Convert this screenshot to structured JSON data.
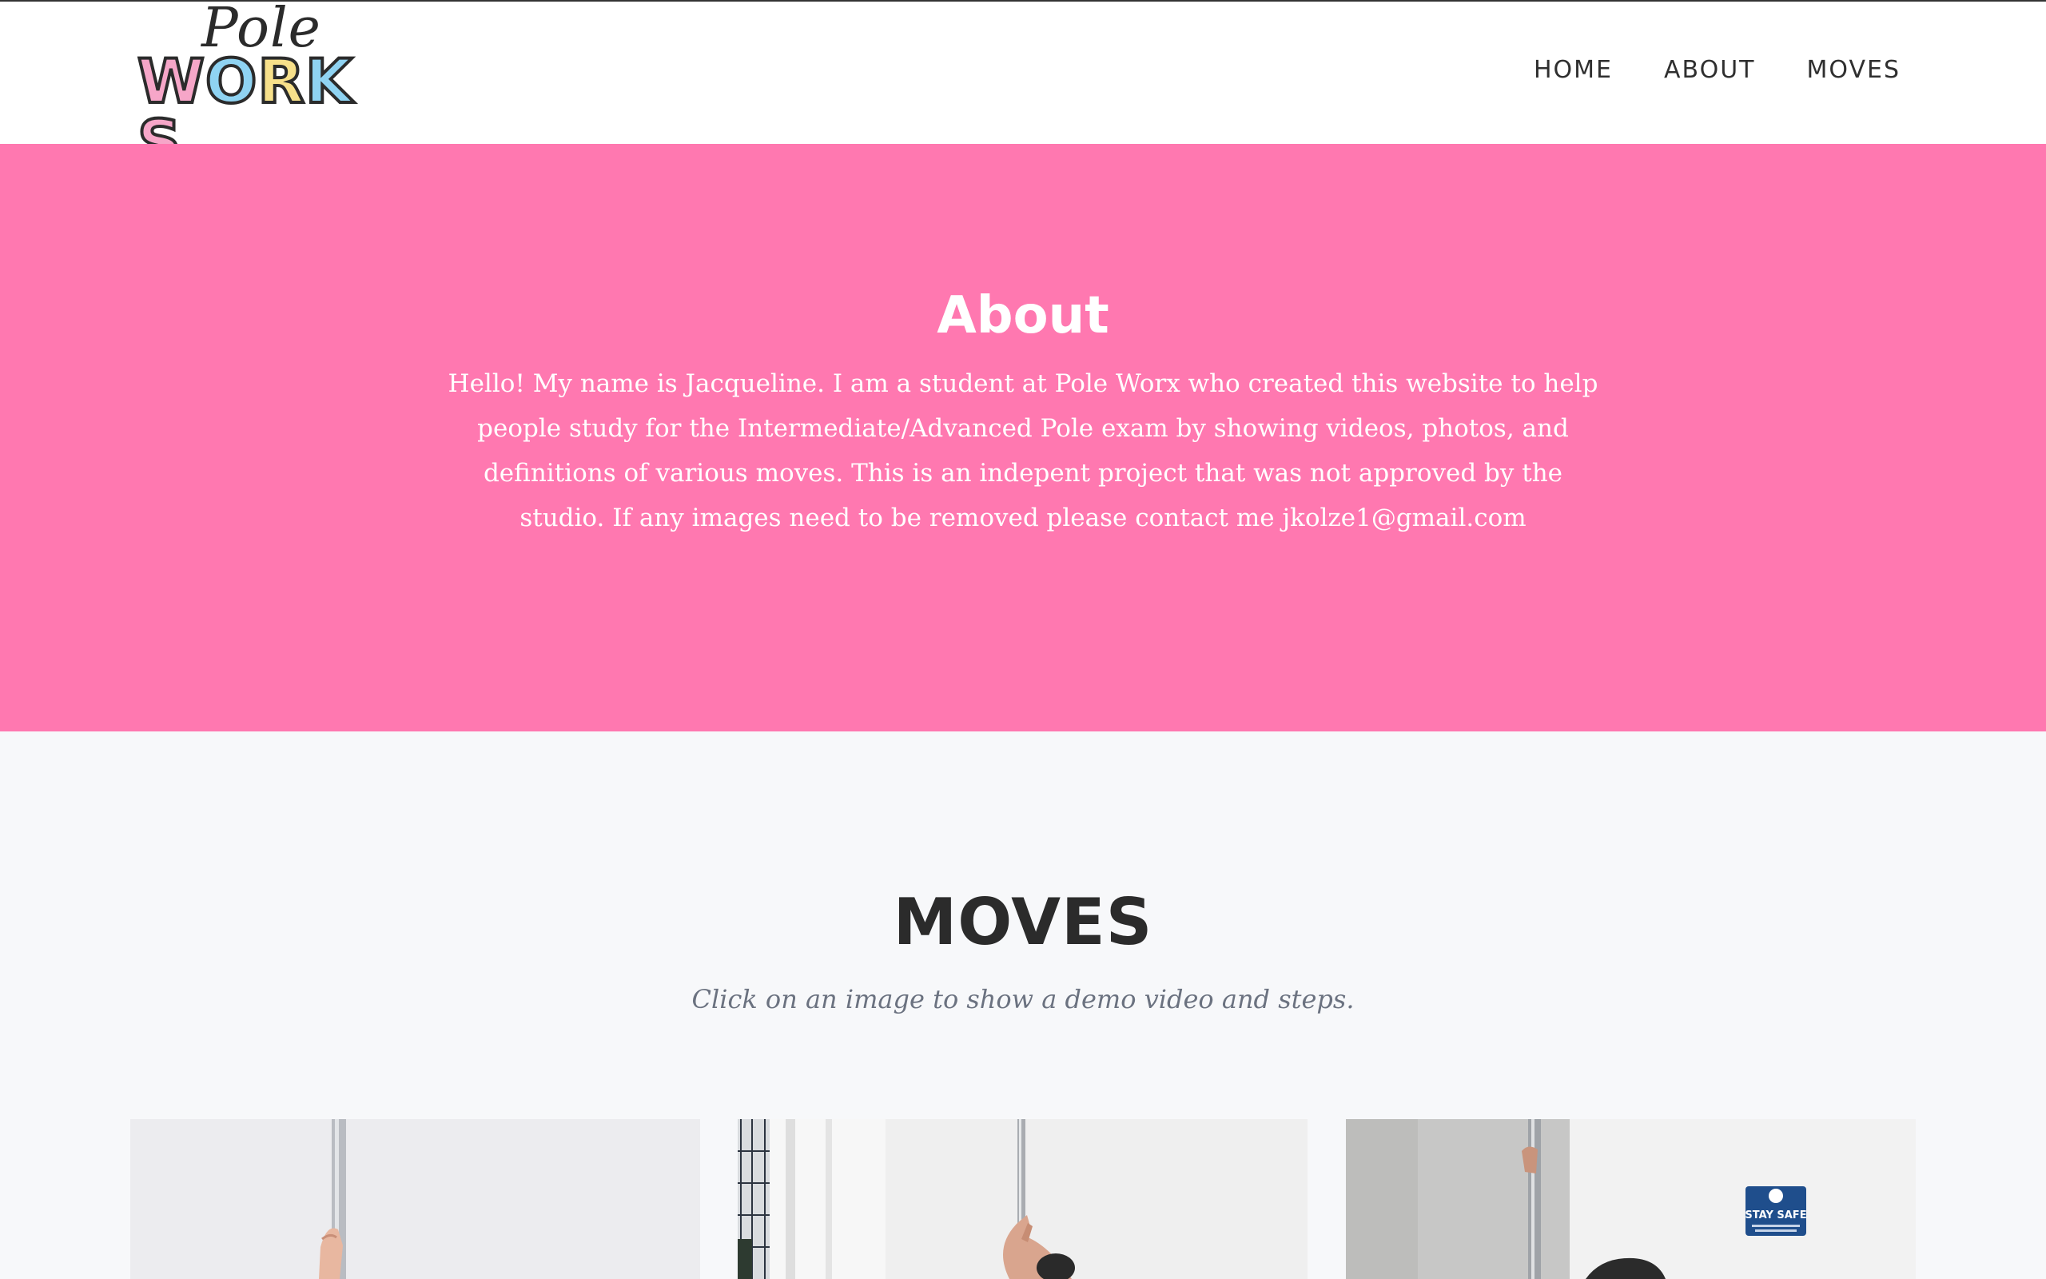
{
  "brand": {
    "script": "Pole",
    "letters": [
      {
        "ch": "W",
        "color": "#f6a6c8"
      },
      {
        "ch": "O",
        "color": "#8fd3f2"
      },
      {
        "ch": "R",
        "color": "#f7e08a"
      },
      {
        "ch": "K",
        "color": "#8fd3f2"
      },
      {
        "ch": "S",
        "color": "#f6a6c8"
      }
    ]
  },
  "nav": {
    "items": [
      "HOME",
      "ABOUT",
      "MOVES"
    ]
  },
  "about": {
    "title": "About",
    "body": "Hello! My name is Jacqueline. I am a student at Pole Worx who created this website to help people study for the Intermediate/Advanced Pole exam by showing videos, photos, and definitions of various moves. This is an indepent project that was not approved by the studio. If any images need to be removed please contact me jkolze1@gmail.com"
  },
  "moves": {
    "title": "MOVES",
    "subtitle": "Click on an image to show a demo video and steps."
  },
  "cards": [
    {
      "sign_text": ""
    },
    {
      "sign_text": ""
    },
    {
      "sign_text": "STAY SAFE"
    }
  ],
  "colors": {
    "accent_pink": "#ff78b0",
    "background": "#f7f8fa",
    "header_bg": "#ffffff",
    "heading_dark": "#2b2b2b",
    "subtitle_gray": "#6b7280",
    "sign_blue": "#1f4e8c"
  }
}
